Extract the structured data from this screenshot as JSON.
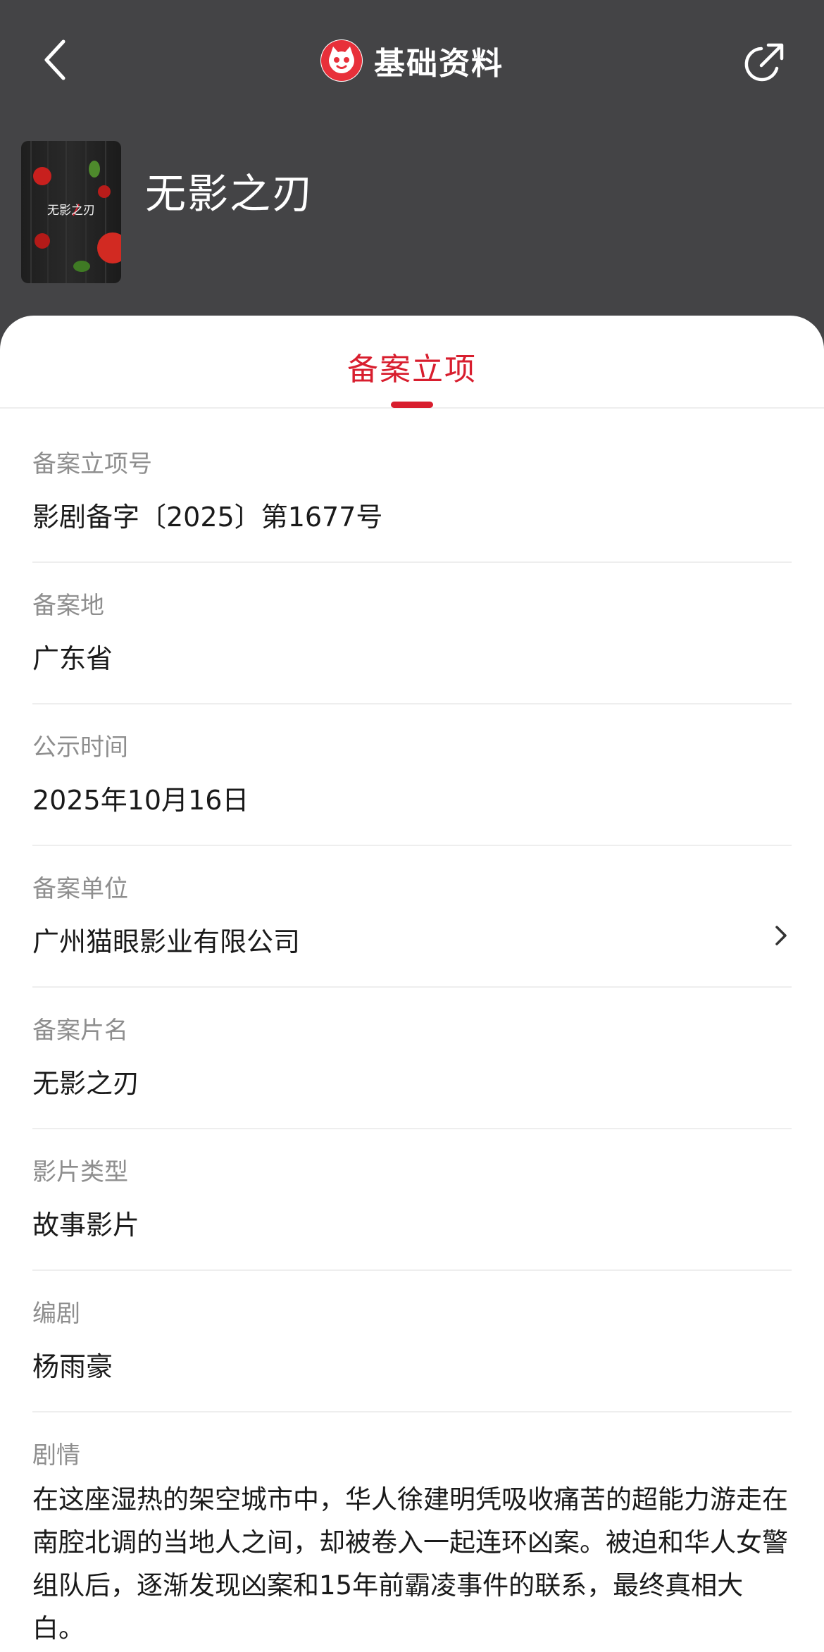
{
  "header": {
    "title": "基础资料",
    "back_icon": "chevron-left-icon",
    "share_icon": "share-icon",
    "logo_icon": "cat-logo-icon"
  },
  "movie": {
    "poster_title": "无影之刃",
    "title": "无影之刃"
  },
  "tabs": [
    {
      "label": "备案立项",
      "active": true
    }
  ],
  "fields": {
    "record_no": {
      "label": "备案立项号",
      "value": "影剧备字〔2025〕第1677号"
    },
    "location": {
      "label": "备案地",
      "value": "广东省"
    },
    "publish_time": {
      "label": "公示时间",
      "value": "2025年10月16日"
    },
    "company": {
      "label": "备案单位",
      "value": "广州猫眼影业有限公司"
    },
    "film_name": {
      "label": "备案片名",
      "value": "无影之刃"
    },
    "film_type": {
      "label": "影片类型",
      "value": "故事影片"
    },
    "screenwriter": {
      "label": "编剧",
      "value": "杨雨豪"
    },
    "plot": {
      "label": "剧情",
      "value": "在这座湿热的架空城市中，华人徐建明凭吸收痛苦的超能力游走在南腔北调的当地人之间，却被卷入一起连环凶案。被迫和华人女警组队后，逐渐发现凶案和15年前霸凌事件的联系，最终真相大白。"
    }
  },
  "colors": {
    "header_bg": "#444446",
    "accent": "#d81e2e",
    "label": "#8e8e8e",
    "value": "#1a1a1a"
  }
}
